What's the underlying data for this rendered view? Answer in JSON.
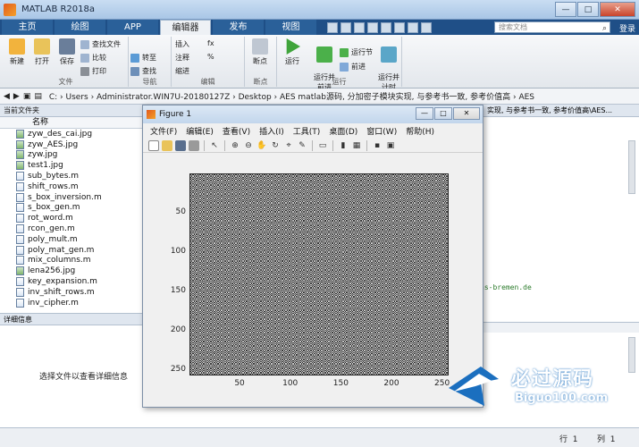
{
  "app": {
    "title": "MATLAB R2018a",
    "window_buttons": {
      "minimize": "—",
      "maximize": "□",
      "close": "✕"
    }
  },
  "tabs": [
    {
      "label": "主页",
      "active": false
    },
    {
      "label": "绘图",
      "active": false
    },
    {
      "label": "APP",
      "active": false
    },
    {
      "label": "编辑器",
      "active": true
    },
    {
      "label": "发布",
      "active": false
    },
    {
      "label": "视图",
      "active": false
    }
  ],
  "search": {
    "placeholder": "搜索文档",
    "login": "登录"
  },
  "ribbon": {
    "file": {
      "new": "新建",
      "open": "打开",
      "save": "保存",
      "find_files": "查找文件",
      "compare": "比较",
      "print": "打印",
      "label": "文件"
    },
    "navigate": {
      "goto": "转至",
      "find": "查找",
      "label": "导航"
    },
    "edit": {
      "insert": "插入",
      "comment": "注释",
      "indent": "缩进",
      "fx": "fx",
      "label": "编辑"
    },
    "breakpoints": {
      "breakpoints": "断点",
      "label": "断点"
    },
    "run": {
      "run": "运行",
      "run_advance": "运行并\n前进",
      "run_section": "运行节",
      "advance": "前进",
      "run_time": "运行并\n计时",
      "label": "运行"
    }
  },
  "address": {
    "path": "C: › Users › Administrator.WIN7U-20180127Z › Desktop › AES matlab源码, 分加密子模块实现, 与参考书一致, 参考价值高 › AES"
  },
  "current_folder": {
    "header": "当前文件夹",
    "column_name": "名称",
    "files": [
      {
        "name": "zyw_des_cai.jpg",
        "type": "img"
      },
      {
        "name": "zyw_AES.jpg",
        "type": "img"
      },
      {
        "name": "zyw.jpg",
        "type": "img"
      },
      {
        "name": "test1.jpg",
        "type": "img"
      },
      {
        "name": "sub_bytes.m",
        "type": "m"
      },
      {
        "name": "shift_rows.m",
        "type": "m"
      },
      {
        "name": "s_box_inversion.m",
        "type": "m"
      },
      {
        "name": "s_box_gen.m",
        "type": "m"
      },
      {
        "name": "rot_word.m",
        "type": "m"
      },
      {
        "name": "rcon_gen.m",
        "type": "m"
      },
      {
        "name": "poly_mult.m",
        "type": "m"
      },
      {
        "name": "poly_mat_gen.m",
        "type": "m"
      },
      {
        "name": "mix_columns.m",
        "type": "m"
      },
      {
        "name": "lena256.jpg",
        "type": "img"
      },
      {
        "name": "key_expansion.m",
        "type": "m"
      },
      {
        "name": "inv_shift_rows.m",
        "type": "m"
      },
      {
        "name": "inv_cipher.m",
        "type": "m"
      }
    ]
  },
  "details": {
    "header": "详细信息",
    "message": "选择文件以查看详细信息"
  },
  "right_pane": {
    "header": "实现, 与参考书一致, 参考价值高\\AES...",
    "snippet": "hs-bremen.de"
  },
  "figure": {
    "title": "Figure 1",
    "menus": [
      "文件(F)",
      "编辑(E)",
      "查看(V)",
      "插入(I)",
      "工具(T)",
      "桌面(D)",
      "窗口(W)",
      "帮助(H)"
    ],
    "y_ticks": [
      "50",
      "100",
      "150",
      "200",
      "250"
    ],
    "x_ticks": [
      "50",
      "100",
      "150",
      "200",
      "250"
    ],
    "y_tick_values": [
      50,
      100,
      150,
      200,
      250
    ],
    "x_tick_values": [
      50,
      100,
      150,
      200,
      250
    ],
    "axis_range": {
      "x": [
        0.5,
        256.5
      ],
      "y": [
        0.5,
        256.5
      ]
    },
    "image_content": "encrypted noise image (black/white pixels)"
  },
  "status": {
    "row_label": "行",
    "row_value": "1",
    "col_label": "列",
    "col_value": "1"
  },
  "watermark": {
    "cn": "必过源码",
    "en": "Biguo100.com"
  },
  "colors": {
    "tab_bar": "#1f4f87",
    "accent": "#e25a1c",
    "watermark": "#1b6fbf"
  }
}
